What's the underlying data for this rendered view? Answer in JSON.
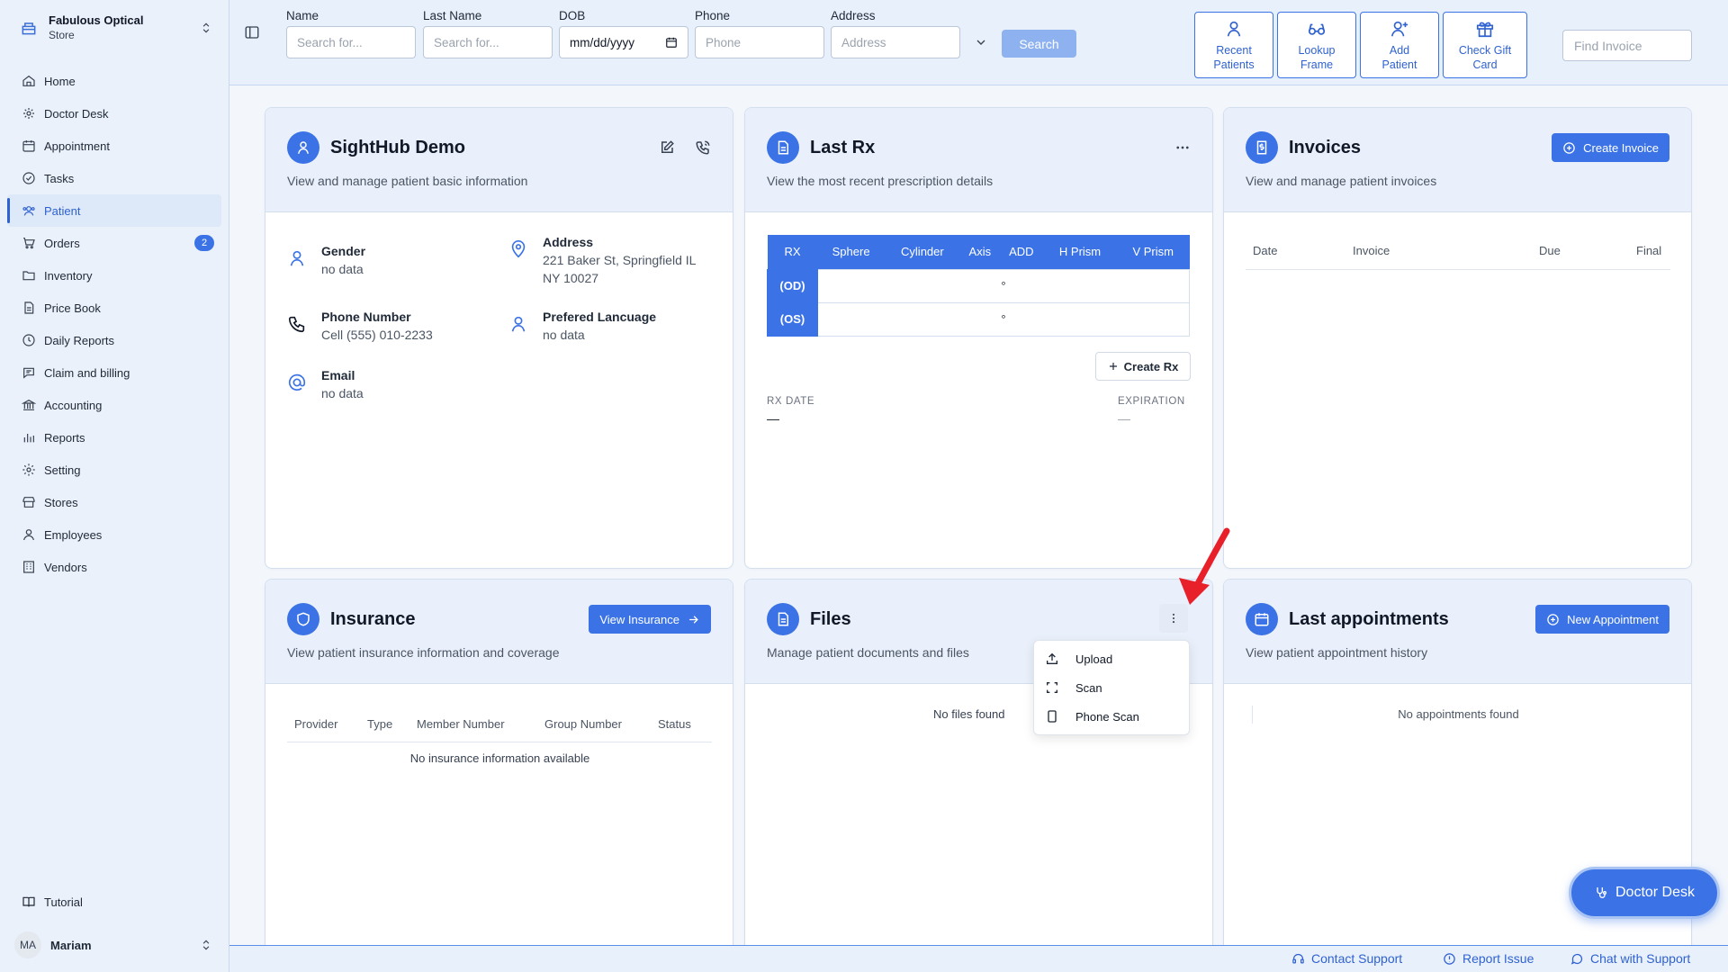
{
  "store": {
    "name": "Fabulous Optical",
    "sub": "Store"
  },
  "nav": [
    {
      "label": "Home",
      "icon": "home-icon"
    },
    {
      "label": "Doctor Desk",
      "icon": "stethoscope-icon"
    },
    {
      "label": "Appointment",
      "icon": "calendar-icon"
    },
    {
      "label": "Tasks",
      "icon": "check-circle-icon"
    },
    {
      "label": "Patient",
      "icon": "patients-icon",
      "active": true
    },
    {
      "label": "Orders",
      "icon": "cart-icon",
      "badge": "2"
    },
    {
      "label": "Inventory",
      "icon": "folder-icon"
    },
    {
      "label": "Price Book",
      "icon": "document-icon"
    },
    {
      "label": "Daily Reports",
      "icon": "clock-icon"
    },
    {
      "label": "Claim and billing",
      "icon": "message-icon"
    },
    {
      "label": "Accounting",
      "icon": "bank-icon"
    },
    {
      "label": "Reports",
      "icon": "bar-chart-icon"
    },
    {
      "label": "Setting",
      "icon": "gear-icon"
    },
    {
      "label": "Stores",
      "icon": "store-icon"
    },
    {
      "label": "Employees",
      "icon": "user-icon"
    },
    {
      "label": "Vendors",
      "icon": "building-icon"
    }
  ],
  "tutorial": "Tutorial",
  "user": {
    "initials": "MA",
    "name": "Mariam"
  },
  "search": {
    "fields": [
      {
        "label": "Name",
        "placeholder": "Search for..."
      },
      {
        "label": "Last Name",
        "placeholder": "Search for..."
      },
      {
        "label": "DOB",
        "placeholder": "mm/dd/yyyy"
      },
      {
        "label": "Phone",
        "placeholder": "Phone"
      },
      {
        "label": "Address",
        "placeholder": "Address"
      }
    ],
    "button": "Search"
  },
  "quick_actions": [
    {
      "label1": "Recent",
      "label2": "Patients"
    },
    {
      "label1": "Lookup",
      "label2": "Frame"
    },
    {
      "label1": "Add",
      "label2": "Patient"
    },
    {
      "label1": "Check Gift",
      "label2": "Card"
    }
  ],
  "find_invoice_placeholder": "Find Invoice",
  "patient_card": {
    "title": "SightHub Demo",
    "desc": "View and manage patient basic information",
    "gender_label": "Gender",
    "gender_value": "no data",
    "address_label": "Address",
    "address_line1": "221 Baker St, Springfield IL",
    "address_line2": "NY 10027",
    "phone_label": "Phone Number",
    "phone_value": "Cell (555) 010-2233",
    "lang_label": "Prefered Lancuage",
    "lang_value": "no data",
    "email_label": "Email",
    "email_value": "no data"
  },
  "rx_card": {
    "title": "Last Rx",
    "desc": "View the most recent prescription details",
    "columns": [
      "RX",
      "Sphere",
      "Cylinder",
      "Axis",
      "ADD",
      "H Prism",
      "V Prism"
    ],
    "rows": [
      {
        "eye": "(OD)",
        "axis": "°"
      },
      {
        "eye": "(OS)",
        "axis": "°"
      }
    ],
    "create_label": "Create Rx",
    "rx_date_label": "RX DATE",
    "rx_date_value": "—",
    "expiration_label": "EXPIRATION",
    "expiration_value": "—"
  },
  "invoices_card": {
    "title": "Invoices",
    "desc": "View and manage patient invoices",
    "button": "Create Invoice",
    "columns": [
      "Date",
      "Invoice",
      "Due",
      "Final"
    ]
  },
  "insurance_card": {
    "title": "Insurance",
    "desc": "View patient insurance information and coverage",
    "button": "View Insurance",
    "columns": [
      "Provider",
      "Type",
      "Member Number",
      "Group Number",
      "Status"
    ],
    "empty": "No insurance information available"
  },
  "files_card": {
    "title": "Files",
    "desc": "Manage patient documents and files",
    "empty": "No files found",
    "menu": [
      "Upload",
      "Scan",
      "Phone Scan"
    ]
  },
  "appointments_card": {
    "title": "Last appointments",
    "desc": "View patient appointment history",
    "button": "New Appointment",
    "empty": "No appointments found"
  },
  "footer": {
    "contact": "Contact Support",
    "report": "Report Issue",
    "chat": "Chat with Support"
  },
  "doctor_desk_button": "Doctor Desk",
  "colors": {
    "accent": "#3b73e6",
    "annotation_arrow": "#e8202a"
  }
}
